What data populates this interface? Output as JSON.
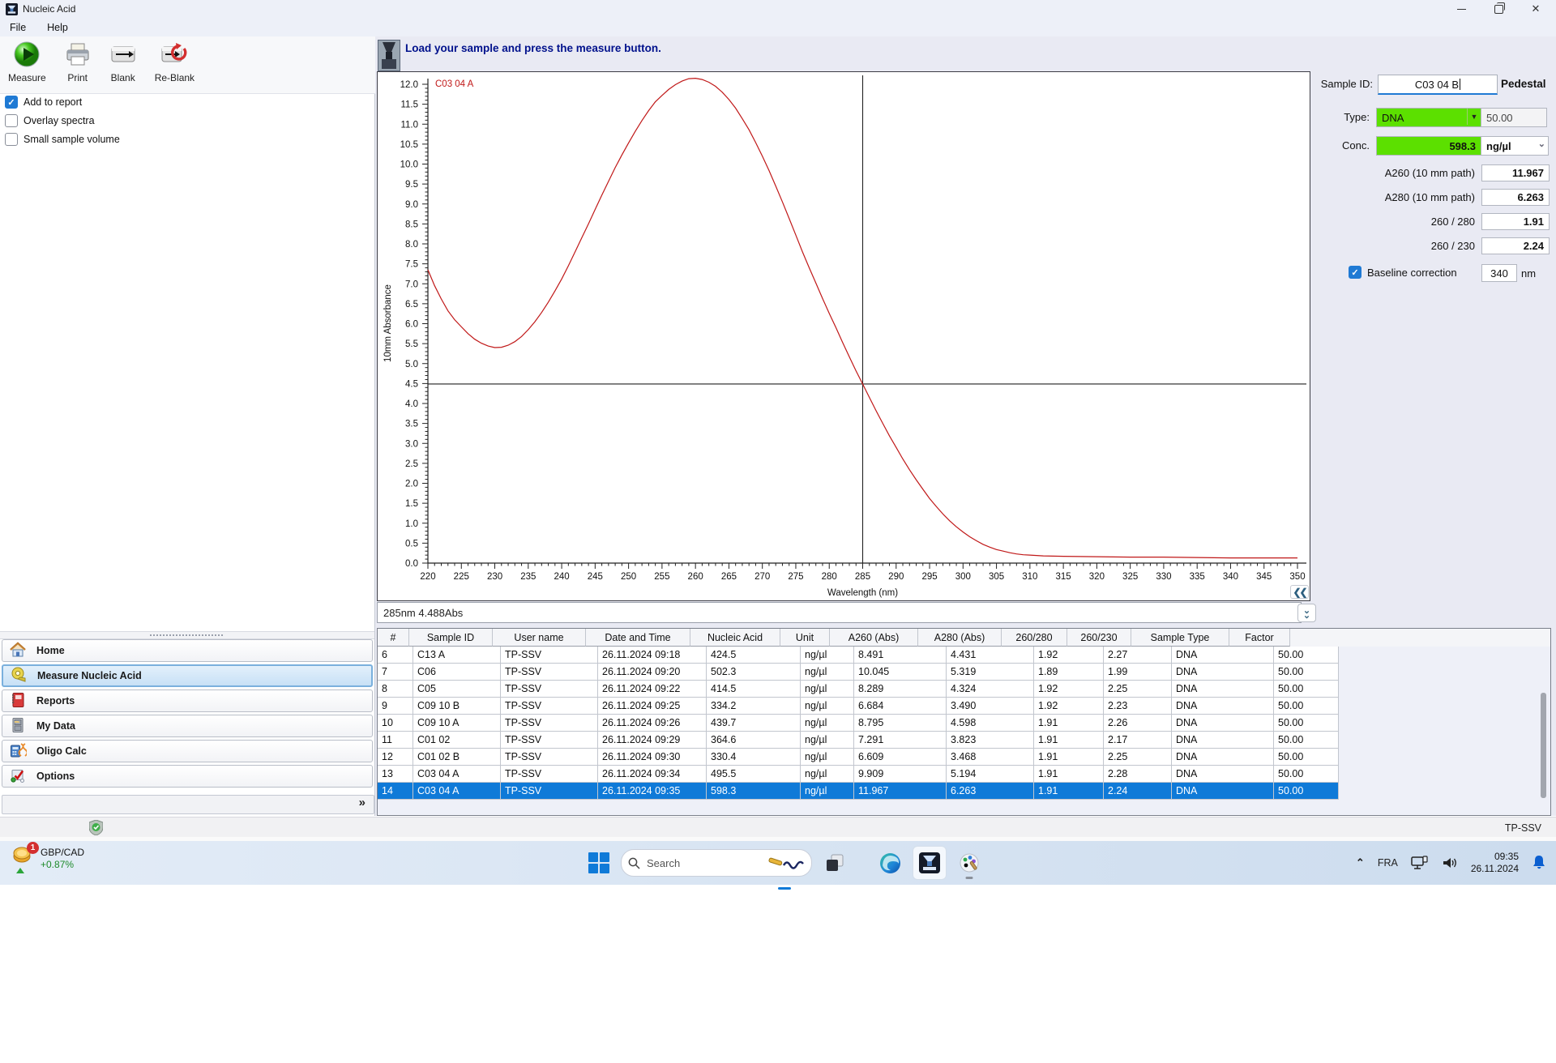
{
  "window": {
    "title": "Nucleic Acid"
  },
  "menu": {
    "items": [
      "File",
      "Help"
    ]
  },
  "toolbar": {
    "buttons": [
      {
        "label": "Measure",
        "icon": "measure-icon"
      },
      {
        "label": "Print",
        "icon": "print-icon"
      },
      {
        "label": "Blank",
        "icon": "blank-icon"
      },
      {
        "label": "Re-Blank",
        "icon": "reblank-icon"
      }
    ]
  },
  "options": [
    {
      "label": "Add to report",
      "checked": true
    },
    {
      "label": "Overlay spectra",
      "checked": false
    },
    {
      "label": "Small sample volume",
      "checked": false
    }
  ],
  "sidebar": {
    "items": [
      {
        "label": "Home",
        "icon": "home-icon",
        "selected": false
      },
      {
        "label": "Measure Nucleic Acid",
        "icon": "measure-tape-icon",
        "selected": true
      },
      {
        "label": "Reports",
        "icon": "reports-icon",
        "selected": false
      },
      {
        "label": "My Data",
        "icon": "mydata-icon",
        "selected": false
      },
      {
        "label": "Oligo Calc",
        "icon": "oligocalc-icon",
        "selected": false
      },
      {
        "label": "Options",
        "icon": "options-icon",
        "selected": false
      }
    ],
    "expander": "»"
  },
  "message_bar": {
    "text": "Load your sample and press the measure button."
  },
  "chart_data": {
    "type": "line",
    "xlabel": "Wavelength (nm)",
    "ylabel": "10mm Absorbance",
    "xlim": [
      220,
      350
    ],
    "ylim": [
      0.0,
      12.0
    ],
    "x_tick_step": 5,
    "y_tick_step": 0.5,
    "grid": false,
    "legend_position": "top-left",
    "legend": [
      {
        "label": "C03 04 A",
        "color": "#c01818"
      }
    ],
    "crosshair": {
      "x": 285,
      "y": 4.488
    },
    "series": [
      {
        "name": "C03 04 A",
        "color": "#c01818",
        "points": [
          [
            220,
            7.35
          ],
          [
            221,
            6.95
          ],
          [
            222,
            6.62
          ],
          [
            223,
            6.32
          ],
          [
            224,
            6.1
          ],
          [
            225,
            5.92
          ],
          [
            226,
            5.75
          ],
          [
            227,
            5.61
          ],
          [
            228,
            5.51
          ],
          [
            229,
            5.44
          ],
          [
            230,
            5.4
          ],
          [
            231,
            5.41
          ],
          [
            232,
            5.46
          ],
          [
            233,
            5.55
          ],
          [
            234,
            5.68
          ],
          [
            235,
            5.85
          ],
          [
            236,
            6.05
          ],
          [
            237,
            6.28
          ],
          [
            238,
            6.54
          ],
          [
            239,
            6.82
          ],
          [
            240,
            7.12
          ],
          [
            241,
            7.45
          ],
          [
            242,
            7.8
          ],
          [
            243,
            8.15
          ],
          [
            244,
            8.5
          ],
          [
            245,
            8.86
          ],
          [
            246,
            9.22
          ],
          [
            247,
            9.57
          ],
          [
            248,
            9.91
          ],
          [
            249,
            10.23
          ],
          [
            250,
            10.53
          ],
          [
            251,
            10.82
          ],
          [
            252,
            11.09
          ],
          [
            253,
            11.34
          ],
          [
            254,
            11.56
          ],
          [
            255,
            11.72
          ],
          [
            256,
            11.87
          ],
          [
            257,
            11.99
          ],
          [
            258,
            12.08
          ],
          [
            259,
            12.14
          ],
          [
            260,
            12.15
          ],
          [
            261,
            12.12
          ],
          [
            262,
            12.05
          ],
          [
            263,
            11.95
          ],
          [
            264,
            11.8
          ],
          [
            265,
            11.62
          ],
          [
            266,
            11.4
          ],
          [
            267,
            11.14
          ],
          [
            268,
            10.86
          ],
          [
            269,
            10.54
          ],
          [
            270,
            10.2
          ],
          [
            271,
            9.84
          ],
          [
            272,
            9.45
          ],
          [
            273,
            9.05
          ],
          [
            274,
            8.64
          ],
          [
            275,
            8.22
          ],
          [
            276,
            7.8
          ],
          [
            277,
            7.4
          ],
          [
            278,
            7.02
          ],
          [
            279,
            6.63
          ],
          [
            280,
            6.26
          ],
          [
            281,
            5.9
          ],
          [
            282,
            5.53
          ],
          [
            283,
            5.17
          ],
          [
            284,
            4.82
          ],
          [
            285,
            4.488
          ],
          [
            286,
            4.15
          ],
          [
            287,
            3.82
          ],
          [
            288,
            3.5
          ],
          [
            289,
            3.19
          ],
          [
            290,
            2.9
          ],
          [
            291,
            2.61
          ],
          [
            292,
            2.34
          ],
          [
            293,
            2.09
          ],
          [
            294,
            1.85
          ],
          [
            295,
            1.62
          ],
          [
            296,
            1.42
          ],
          [
            297,
            1.23
          ],
          [
            298,
            1.06
          ],
          [
            299,
            0.91
          ],
          [
            300,
            0.78
          ],
          [
            301,
            0.66
          ],
          [
            302,
            0.56
          ],
          [
            303,
            0.47
          ],
          [
            304,
            0.4
          ],
          [
            305,
            0.34
          ],
          [
            306,
            0.3
          ],
          [
            307,
            0.26
          ],
          [
            308,
            0.23
          ],
          [
            309,
            0.21
          ],
          [
            310,
            0.2
          ],
          [
            312,
            0.18
          ],
          [
            315,
            0.17
          ],
          [
            320,
            0.16
          ],
          [
            325,
            0.15
          ],
          [
            330,
            0.15
          ],
          [
            335,
            0.14
          ],
          [
            340,
            0.13
          ],
          [
            345,
            0.13
          ],
          [
            350,
            0.13
          ]
        ]
      }
    ]
  },
  "cursor_readout": "285nm 4.488Abs",
  "sample_panel": {
    "sample_id_label": "Sample ID:",
    "sample_id_value": "C03 04 B",
    "mode_label": "Pedestal",
    "type_label": "Type:",
    "type_value": "DNA",
    "factor_value": "50.00",
    "conc_label": "Conc.",
    "conc_value": "598.3",
    "unit_value": "ng/µl",
    "fields": [
      {
        "label": "A260 (10 mm path)",
        "value": "11.967"
      },
      {
        "label": "A280 (10 mm path)",
        "value": "6.263"
      },
      {
        "label": "260 / 280",
        "value": "1.91"
      },
      {
        "label": "260 / 230",
        "value": "2.24"
      }
    ],
    "baseline_label": "Baseline correction",
    "baseline_checked": true,
    "baseline_value": "340",
    "baseline_unit": "nm"
  },
  "results_table": {
    "headers": [
      "#",
      "Sample ID",
      "User name",
      "Date and Time",
      "Nucleic Acid",
      "Unit",
      "A260 (Abs)",
      "A280 (Abs)",
      "260/280",
      "260/230",
      "Sample Type",
      "Factor"
    ],
    "rows": [
      [
        "6",
        "C13 A",
        "TP-SSV",
        "26.11.2024 09:18",
        "424.5",
        "ng/µl",
        "8.491",
        "4.431",
        "1.92",
        "2.27",
        "DNA",
        "50.00"
      ],
      [
        "7",
        "C06",
        "TP-SSV",
        "26.11.2024 09:20",
        "502.3",
        "ng/µl",
        "10.045",
        "5.319",
        "1.89",
        "1.99",
        "DNA",
        "50.00"
      ],
      [
        "8",
        "C05",
        "TP-SSV",
        "26.11.2024 09:22",
        "414.5",
        "ng/µl",
        "8.289",
        "4.324",
        "1.92",
        "2.25",
        "DNA",
        "50.00"
      ],
      [
        "9",
        "C09 10 B",
        "TP-SSV",
        "26.11.2024 09:25",
        "334.2",
        "ng/µl",
        "6.684",
        "3.490",
        "1.92",
        "2.23",
        "DNA",
        "50.00"
      ],
      [
        "10",
        "C09 10 A",
        "TP-SSV",
        "26.11.2024 09:26",
        "439.7",
        "ng/µl",
        "8.795",
        "4.598",
        "1.91",
        "2.26",
        "DNA",
        "50.00"
      ],
      [
        "11",
        "C01 02",
        "TP-SSV",
        "26.11.2024 09:29",
        "364.6",
        "ng/µl",
        "7.291",
        "3.823",
        "1.91",
        "2.17",
        "DNA",
        "50.00"
      ],
      [
        "12",
        "C01 02 B",
        "TP-SSV",
        "26.11.2024 09:30",
        "330.4",
        "ng/µl",
        "6.609",
        "3.468",
        "1.91",
        "2.25",
        "DNA",
        "50.00"
      ],
      [
        "13",
        "C03 04 A",
        "TP-SSV",
        "26.11.2024 09:34",
        "495.5",
        "ng/µl",
        "9.909",
        "5.194",
        "1.91",
        "2.28",
        "DNA",
        "50.00"
      ],
      [
        "14",
        "C03 04 A",
        "TP-SSV",
        "26.11.2024 09:35",
        "598.3",
        "ng/µl",
        "11.967",
        "6.263",
        "1.91",
        "2.24",
        "DNA",
        "50.00"
      ]
    ],
    "selected_row_index": 8
  },
  "status_bar": {
    "user": "TP-SSV"
  },
  "taskbar": {
    "widget": {
      "pair": "GBP/CAD",
      "change": "+0.87%",
      "badge": "1"
    },
    "search_placeholder": "Search",
    "language": "FRA",
    "time": "09:35",
    "date": "26.11.2024"
  },
  "colors": {
    "accent_green": "#5ce000",
    "selection_blue": "#0f7ad8",
    "curve_red": "#c01818",
    "message_blue": "#00118c"
  }
}
